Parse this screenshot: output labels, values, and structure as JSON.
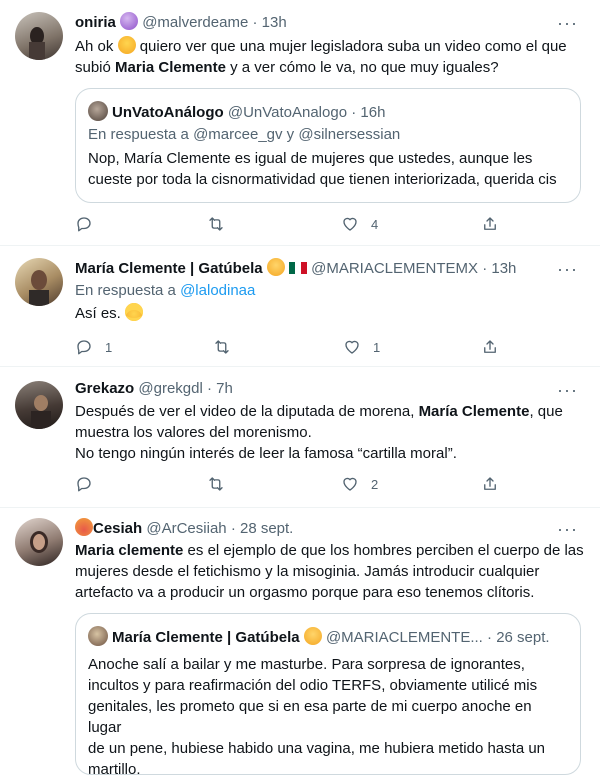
{
  "tweets": [
    {
      "name": "oniria",
      "name_emoji": "crystal-ball",
      "handle": "@malverdeame",
      "time": "· 13h",
      "lines": [
        {
          "a": "Ah ok ",
          "emoji": "joy",
          "b": " quiero ver que una mujer legisladora suba un video como el que"
        },
        {
          "a": "subió ",
          "bold": "Maria Clemente",
          "b": " y a ver cómo le va, no que muy iguales?"
        }
      ],
      "quote": {
        "name": "UnVatoAnálogo",
        "handle": "@UnVatoAnalogo",
        "time": "· 16h",
        "reply_prefix": "En respuesta a ",
        "reply_to": "@marcee_gv y @silnersessian",
        "lines": [
          "Nop, María Clemente es igual de mujeres que ustedes, aunque les",
          "cueste por toda la cisnormatividad que tienen interiorizada, querida cis"
        ]
      },
      "reply_count": "",
      "retweet_count": "",
      "like_count": "4"
    },
    {
      "name": "María Clemente | Gatúbela",
      "name_emoji": "kissing-cat",
      "name_flag": "mexico-flag",
      "handle": "@MARIACLEMENTEMX",
      "time": "· 13h",
      "reply_prefix": "En respuesta a ",
      "reply_to": "@lalodinaa",
      "text": "Así es. ",
      "text_emoji": "sunglasses",
      "reply_count": "1",
      "retweet_count": "",
      "like_count": "1"
    },
    {
      "name": "Grekazo",
      "handle": "@grekgdl",
      "time": "· 7h",
      "lines": [
        {
          "a": "Después de ver el video de la diputada de morena, ",
          "bold": "María Clemente",
          "b": ", que"
        },
        {
          "a": "muestra los valores del morenismo."
        },
        {
          "a": "No tengo ningún interés de leer la famosa “cartilla moral”."
        }
      ],
      "reply_count": "",
      "retweet_count": "",
      "like_count": "2"
    },
    {
      "name_prefix_emoji": "fire-heart",
      "name": "Cesiah",
      "handle": "@ArCesiiah",
      "time": "· 28 sept.",
      "lines": [
        {
          "bold": "Maria clemente",
          "b": " es el ejemplo de que los hombres perciben el cuerpo de las"
        },
        {
          "a": "mujeres desde el fetichismo y la misoginia. Jamás introducir cualquier"
        },
        {
          "a": "artefacto va a producir un orgasmo porque para eso tenemos clítoris."
        }
      ],
      "quote": {
        "name": "María Clemente | Gatúbela",
        "handle": "@MARIACLEMENTE...",
        "time": "· 26 sept.",
        "lines": [
          "Anoche salí a bailar y me masturbe. Para sorpresa de ignorantes,",
          "incultos y para reafirmación del odio TERFS, obviamente utilicé mis",
          "genitales, les prometo que si en esa parte de mi cuerpo anoche en lugar",
          "de un pene, hubiese habido una vagina, me hubiera metido hasta un",
          "martillo."
        ]
      }
    }
  ],
  "more_glyph": "···",
  "colors": {
    "link": "#1d9bf0",
    "muted": "#536471",
    "text": "#0f1419",
    "border": "#cfd9de"
  }
}
